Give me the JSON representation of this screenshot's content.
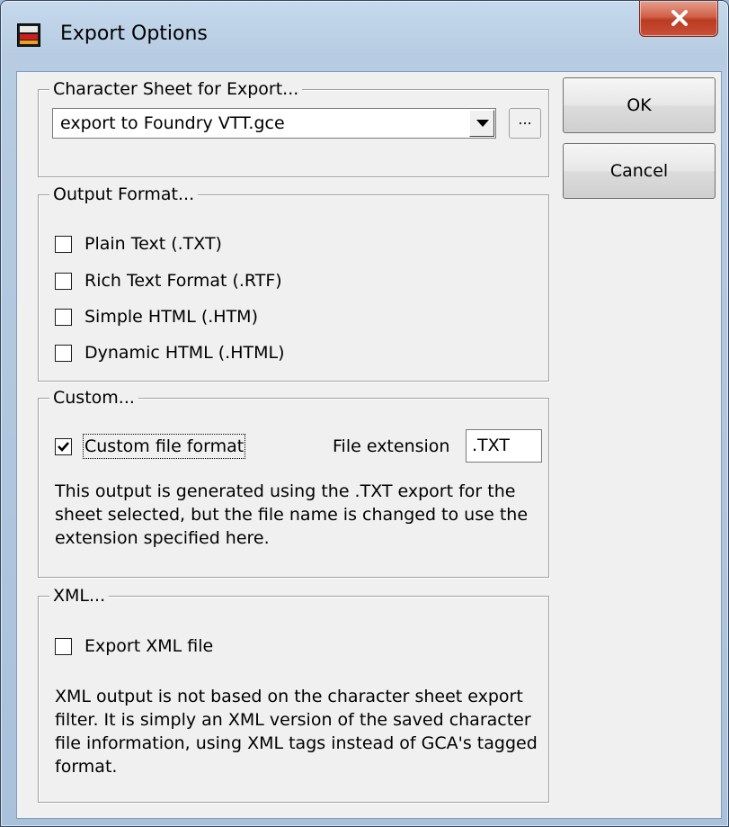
{
  "window": {
    "title": "Export Options"
  },
  "sheet_group": {
    "legend": "Character Sheet for Export...",
    "selected": "export to Foundry VTT.gce",
    "browse_label": "..."
  },
  "buttons": {
    "ok": "OK",
    "cancel": "Cancel"
  },
  "output_group": {
    "legend": "Output Format...",
    "options": [
      {
        "label": "Plain Text (.TXT)",
        "checked": false
      },
      {
        "label": "Rich Text Format (.RTF)",
        "checked": false
      },
      {
        "label": "Simple HTML (.HTM)",
        "checked": false
      },
      {
        "label": "Dynamic HTML (.HTML)",
        "checked": false
      }
    ]
  },
  "custom_group": {
    "legend": "Custom...",
    "checkbox_label": "Custom file format",
    "checked": true,
    "extension_label": "File extension",
    "extension_value": ".TXT",
    "description": "This output is generated using the .TXT export for the sheet selected, but the file name is changed to use the extension specified here."
  },
  "xml_group": {
    "legend": "XML...",
    "checkbox_label": "Export XML file",
    "checked": false,
    "description": "XML output is not based on the character sheet export filter. It is simply an XML version of the saved character file information, using XML tags instead of GCA's tagged format."
  }
}
